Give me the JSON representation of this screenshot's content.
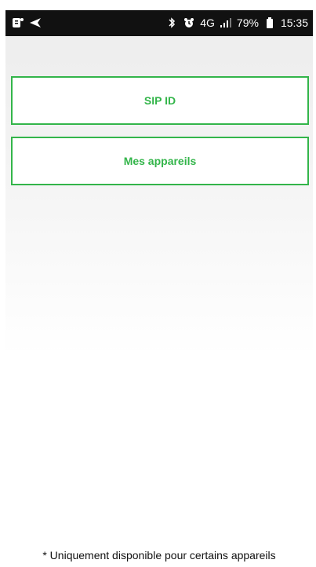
{
  "status_bar": {
    "network": "4G",
    "battery": "79%",
    "time": "15:35",
    "icons": [
      "notification-icon",
      "navigation-icon",
      "bluetooth-icon",
      "alarm-icon",
      "signal-icon",
      "battery-icon"
    ]
  },
  "menu": {
    "items": [
      {
        "label": "SIP ID"
      },
      {
        "label": "Mes appareils"
      }
    ]
  },
  "footer": {
    "note": "* Uniquement disponible pour certains appareils"
  },
  "colors": {
    "accent": "#33b54a",
    "status_bar": "#111111"
  }
}
